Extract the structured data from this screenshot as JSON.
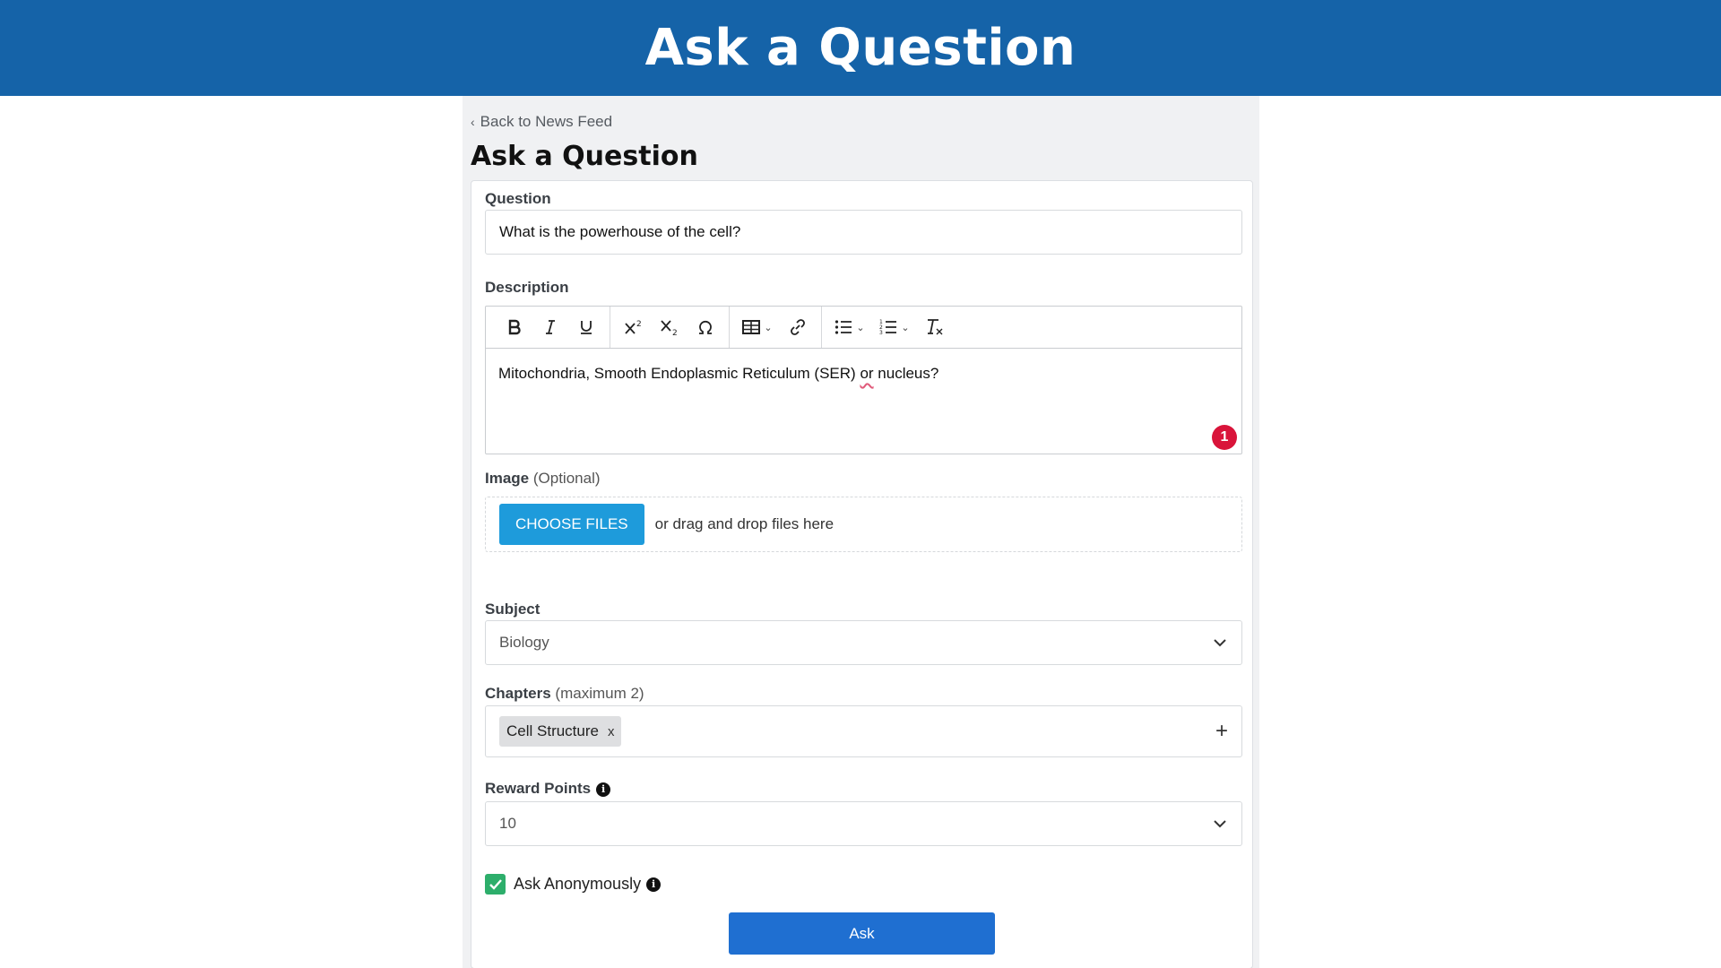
{
  "banner": {
    "title": "Ask a Question"
  },
  "page": {
    "back_link": "Back to News Feed",
    "title": "Ask a Question"
  },
  "form": {
    "question": {
      "label": "Question",
      "value": "What is the powerhouse of the cell?"
    },
    "description": {
      "label": "Description",
      "text_before": "Mitochondria, Smooth Endoplasmic Reticulum (SER) ",
      "text_misspelled": "or",
      "text_after": " nucleus?",
      "badge_count": "1",
      "toolbar": [
        "bold-icon",
        "italic-icon",
        "underline-icon",
        "superscript-icon",
        "subscript-icon",
        "special-character-icon",
        "table-icon",
        "link-icon",
        "bulleted-list-icon",
        "numbered-list-icon",
        "clear-formatting-icon"
      ]
    },
    "image": {
      "label": "Image",
      "label_suffix": "(Optional)",
      "choose_button": "CHOOSE FILES",
      "drop_text": "or drag and drop files here"
    },
    "subject": {
      "label": "Subject",
      "value": "Biology"
    },
    "chapters": {
      "label": "Chapters",
      "label_suffix": "(maximum 2)",
      "chips": [
        "Cell Structure"
      ],
      "remove_glyph": "x",
      "add_glyph": "+"
    },
    "reward": {
      "label": "Reward Points",
      "value": "10"
    },
    "anonymous": {
      "label": "Ask Anonymously",
      "checked": true
    },
    "submit": "Ask"
  },
  "colors": {
    "banner": "#1563a8",
    "choose_button": "#1e9bdb",
    "ask_button": "#1f6fd1",
    "checkbox": "#2dae6b",
    "badge": "#d9143a"
  }
}
